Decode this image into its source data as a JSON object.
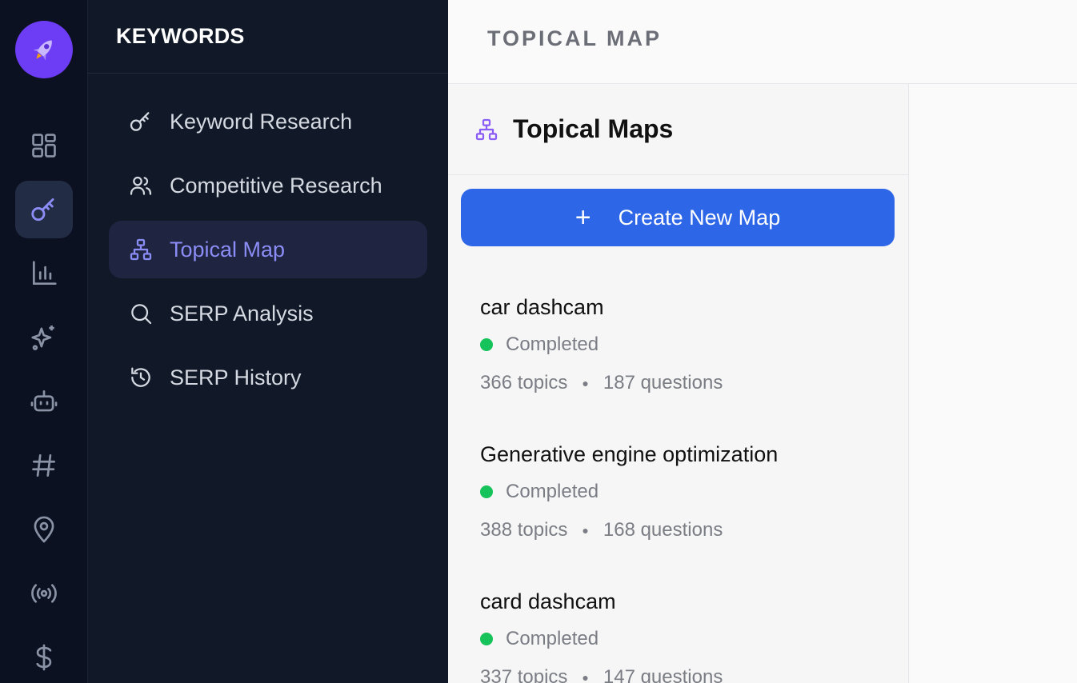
{
  "rail": {
    "items": [
      {
        "icon": "dashboard-grid-icon",
        "active": false
      },
      {
        "icon": "key-icon",
        "active": true
      },
      {
        "icon": "bar-chart-icon",
        "active": false
      },
      {
        "icon": "sparkles-icon",
        "active": false
      },
      {
        "icon": "robot-icon",
        "active": false
      },
      {
        "icon": "hashtag-icon",
        "active": false
      },
      {
        "icon": "map-pin-icon",
        "active": false
      },
      {
        "icon": "broadcast-icon",
        "active": false
      },
      {
        "icon": "dollar-icon",
        "active": false
      }
    ]
  },
  "subnav": {
    "title": "KEYWORDS",
    "items": [
      {
        "label": "Keyword Research",
        "icon": "key-icon",
        "active": false
      },
      {
        "label": "Competitive Research",
        "icon": "users-icon",
        "active": false
      },
      {
        "label": "Topical Map",
        "icon": "sitemap-icon",
        "active": true
      },
      {
        "label": "SERP Analysis",
        "icon": "search-icon",
        "active": false
      },
      {
        "label": "SERP History",
        "icon": "history-icon",
        "active": false
      }
    ]
  },
  "header": {
    "title": "TOPICAL MAP"
  },
  "list": {
    "title": "Topical Maps",
    "create_label": "Create New Map",
    "items": [
      {
        "name": "car dashcam",
        "status": "Completed",
        "topics": "366 topics",
        "questions": "187 questions"
      },
      {
        "name": "Generative engine optimization",
        "status": "Completed",
        "topics": "388 topics",
        "questions": "168 questions"
      },
      {
        "name": "card dashcam",
        "status": "Completed",
        "topics": "337 topics",
        "questions": "147 questions"
      }
    ]
  },
  "colors": {
    "accent": "#2e66e8",
    "active_nav": "#8b8cf6",
    "status_completed": "#16c25a"
  }
}
